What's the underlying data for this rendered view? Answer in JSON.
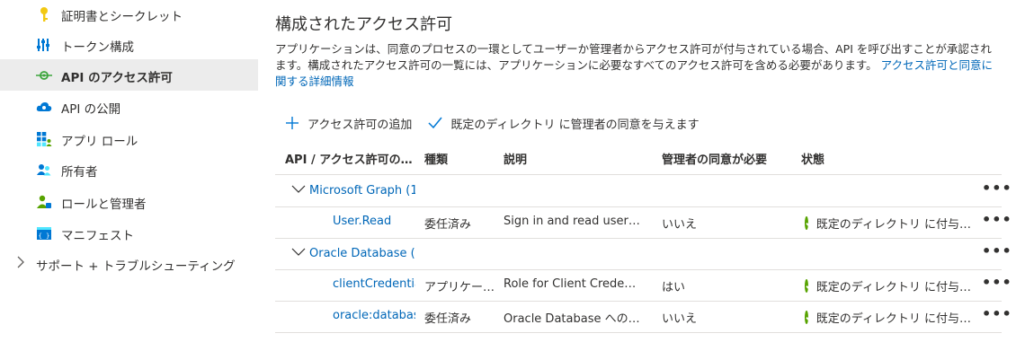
{
  "sidebar": {
    "items": [
      {
        "label": "証明書とシークレット",
        "icon": "key-icon"
      },
      {
        "label": "トークン構成",
        "icon": "token-config-icon"
      },
      {
        "label": "API のアクセス許可",
        "icon": "api-permissions-icon",
        "active": true
      },
      {
        "label": "API の公開",
        "icon": "cloud-icon"
      },
      {
        "label": "アプリ ロール",
        "icon": "app-roles-icon"
      },
      {
        "label": "所有者",
        "icon": "owners-icon"
      },
      {
        "label": "ロールと管理者",
        "icon": "roles-admins-icon"
      },
      {
        "label": "マニフェスト",
        "icon": "manifest-icon"
      },
      {
        "label": "サポート + トラブルシューティング",
        "icon": "chevron-right-icon"
      }
    ]
  },
  "main": {
    "title": "構成されたアクセス許可",
    "description_1": "アプリケーションは、同意のプロセスの一環としてユーザーか管理者からアクセス許可が付与されている場合、API を呼び出すことが承認されます。構成されたアクセス許可の一覧には、アプリケーションに必要なすべてのアクセス許可を含める必要があります。",
    "description_link": "アクセス許可と同意に関する詳細情報"
  },
  "toolbar": {
    "add_label": "アクセス許可の追加",
    "grant_label": "既定のディレクトリ に管理者の同意を与えます"
  },
  "table": {
    "headers": {
      "api": "API / アクセス許可の…",
      "type": "種類",
      "description": "説明",
      "admin_consent": "管理者の同意が必要",
      "status": "状態"
    },
    "groups": [
      {
        "name": "Microsoft Graph (1",
        "permissions": [
          {
            "name": "User.Read",
            "type": "委任済み",
            "description": "Sign in and read user…",
            "admin_consent": "いいえ",
            "status": "既定のディレクトリ に付与…"
          }
        ]
      },
      {
        "name": "Oracle Database (",
        "permissions": [
          {
            "name": "clientCredentia",
            "type": "アプリケー…",
            "description": "Role for Client Crede…",
            "admin_consent": "はい",
            "status": "既定のディレクトリ に付与…"
          },
          {
            "name": "oracle:databas",
            "type": "委任済み",
            "description": "Oracle Database への…",
            "admin_consent": "いいえ",
            "status": "既定のディレクトリ に付与…"
          }
        ]
      }
    ],
    "more_label": "•••"
  },
  "colors": {
    "link": "#0067b8",
    "active_bg": "#ececec",
    "success": "#57a300"
  }
}
